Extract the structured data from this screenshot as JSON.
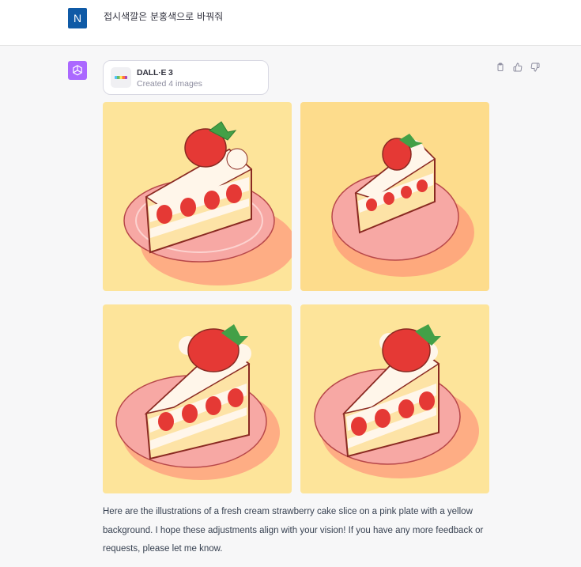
{
  "user": {
    "avatar_letter": "N",
    "message": "접시색깔은 분홍색으로 바꿔줘"
  },
  "assistant": {
    "tool_card": {
      "title": "DALL·E 3",
      "subtitle": "Created 4 images"
    },
    "images": [
      {
        "name": "cake-image-1"
      },
      {
        "name": "cake-image-2"
      },
      {
        "name": "cake-image-3"
      },
      {
        "name": "cake-image-4"
      }
    ],
    "reply": "Here are the illustrations of a fresh cream strawberry cake slice on a pink plate with a yellow background. I hope these adjustments align with your vision! If you have any more feedback or requests, please let me know."
  },
  "icons": {
    "assistant_avatar": "openai-logo-icon",
    "copy": "clipboard-icon",
    "like": "thumbs-up-icon",
    "dislike": "thumbs-down-icon"
  },
  "colors": {
    "user_avatar_bg": "#0f5aa6",
    "assistant_avatar_bg": "#ab68ff",
    "image_bg": "#fde49a",
    "plate": "#f59a9a",
    "strawberry": "#e53935",
    "cream": "#fff6ea"
  }
}
